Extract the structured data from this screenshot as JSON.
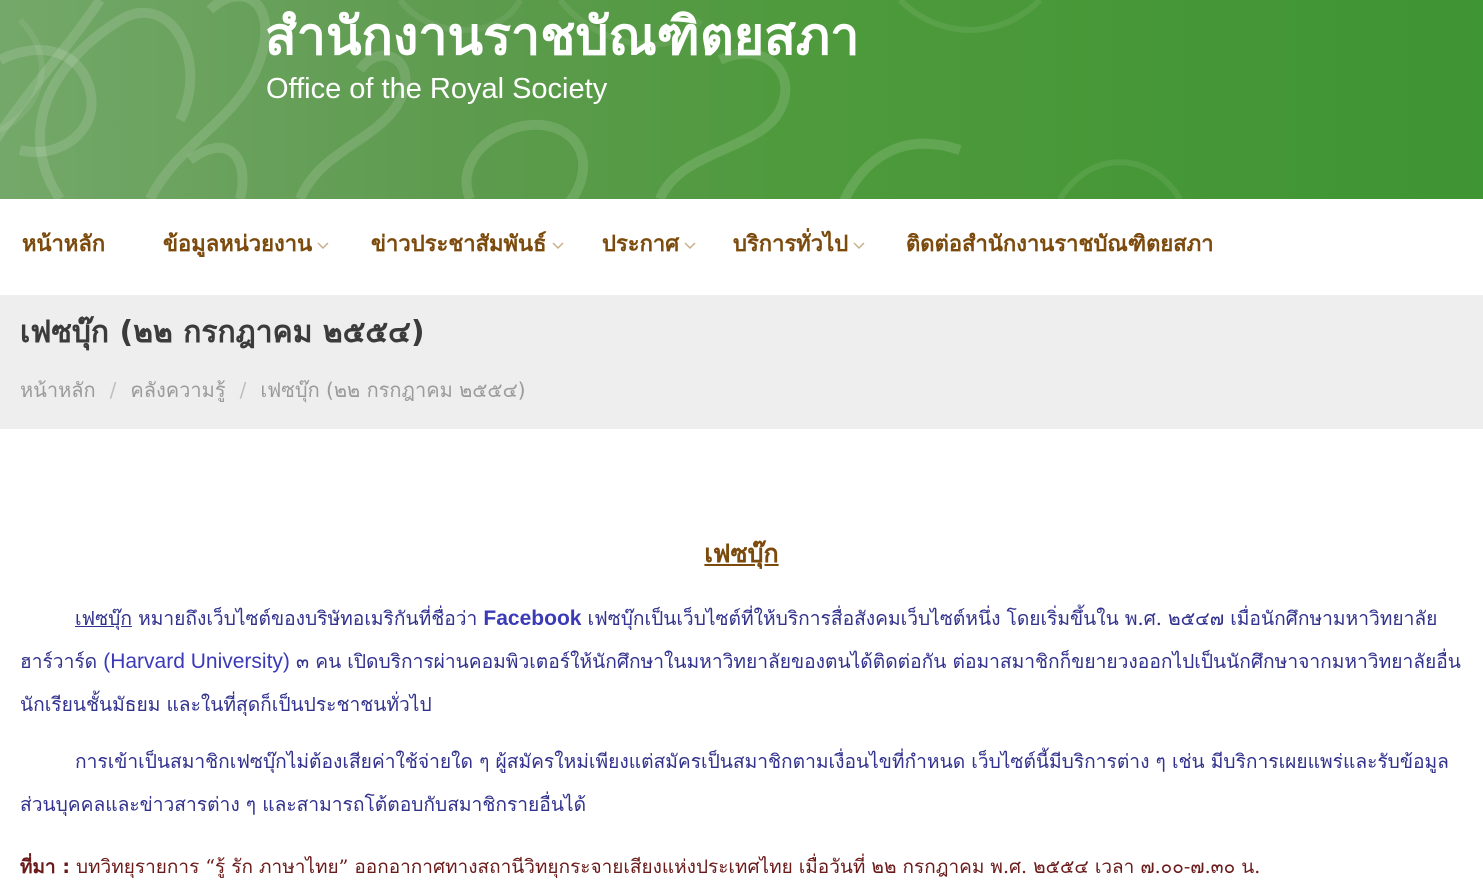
{
  "header": {
    "title": "สำนักงานราชบัณฑิตยสภา",
    "subtitle": "Office of the Royal Society"
  },
  "nav": {
    "items": [
      {
        "label": "หน้าหลัก",
        "dropdown": false
      },
      {
        "label": "ข้อมูลหน่วยงาน",
        "dropdown": true
      },
      {
        "label": "ข่าวประชาสัมพันธ์",
        "dropdown": true
      },
      {
        "label": "ประกาศ",
        "dropdown": true
      },
      {
        "label": "บริการทั่วไป",
        "dropdown": true
      },
      {
        "label": "ติดต่อสำนักงานราชบัณฑิตยสภา",
        "dropdown": false
      }
    ]
  },
  "page": {
    "title": "เฟซบุ๊ก (๒๒ กรกฎาคม ๒๕๕๔)",
    "breadcrumb": [
      "หน้าหลัก",
      "คลังความรู้",
      "เฟซบุ๊ก (๒๒ กรกฎาคม ๒๕๕๔)"
    ],
    "breadcrumb_sep": "/"
  },
  "article": {
    "heading": "เฟซบุ๊ก",
    "p1": {
      "link": "เฟซบุ๊ก",
      "t1": " หมายถึงเว็บไซต์ของบริษัทอเมริกันที่ชื่อว่า ",
      "facebook": "Facebook",
      "t2": " เฟซบุ๊กเป็นเว็บไซต์ที่ให้บริการสื่อสังคมเว็บไซต์หนึ่ง โดยเริ่มขึ้นใน พ.ศ. ๒๕๔๗ เมื่อนักศึกษามหาวิทยาลัยฮาร์วาร์ด ",
      "harvard": "(Harvard University)",
      "t3": " ๓ คน เปิดบริการผ่านคอมพิวเตอร์ให้นักศึกษาในมหาวิทยาลัยของตนได้ติดต่อกัน ต่อมาสมาชิกก็ขยายวงออกไปเป็นนักศึกษาจากมหาวิทยาลัยอื่น นักเรียนชั้นมัธยม และในที่สุดก็เป็นประชาชนทั่วไป"
    },
    "p2": "การเข้าเป็นสมาชิกเฟซบุ๊กไม่ต้องเสียค่าใช้จ่ายใด ๆ ผู้สมัครใหม่เพียงแต่สมัครเป็นสมาชิกตามเงื่อนไขที่กำหนด เว็บไซต์นี้มีบริการต่าง ๆ เช่น มีบริการเผยแพร่และรับข้อมูลส่วนบุคคลและข่าวสารต่าง ๆ และสามารถโต้ตอบกับสมาชิกรายอื่นได้",
    "source_label": "ที่มา :",
    "source_text": " บทวิทยุรายการ “รู้ รัก ภาษาไทย”  ออกอากาศทางสถานีวิทยุกระจายเสียงแห่งประเทศไทย เมื่อวันที่ ๒๒ กรกฎาคม พ.ศ. ๒๕๕๔ เวลา ๗.๐๐-๗.๓๐ น."
  },
  "colors": {
    "header_green": "#4e9a3c",
    "nav_text": "#7b4a0c",
    "body_text": "#32328e",
    "source_text": "#6b1a1a",
    "title_bar_bg": "#eeeeee"
  },
  "icons": {
    "nav_dropdown": "chevron-down-icon",
    "header_background": "thai-floral-pattern"
  }
}
